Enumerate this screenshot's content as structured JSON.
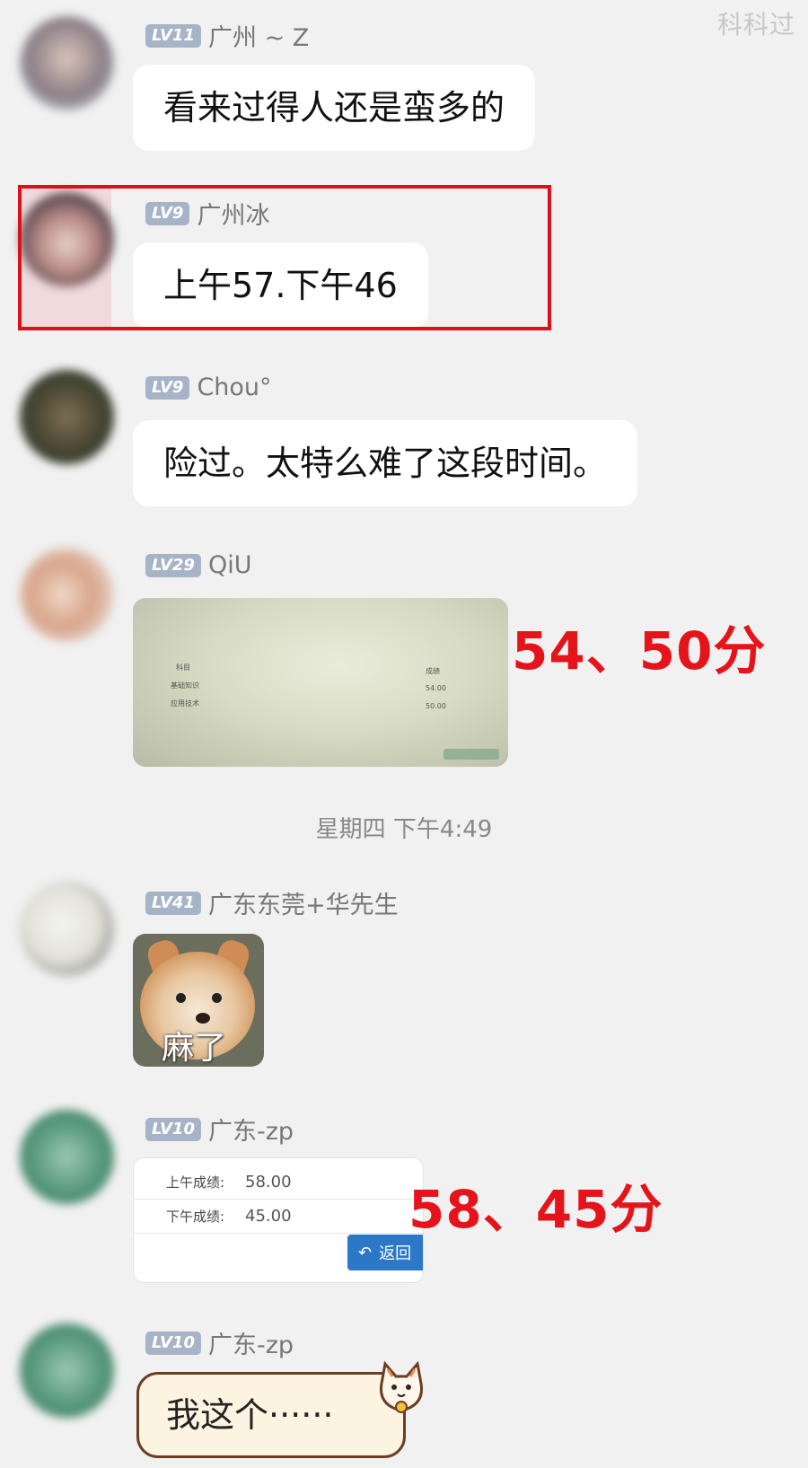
{
  "watermark": "科科过",
  "messages": [
    {
      "level": "LV11",
      "name": "广州 ~ Z",
      "text": "看来过得人还是蛮多的"
    },
    {
      "level": "LV9",
      "name": "广州冰",
      "text": "上午57.下午46"
    },
    {
      "level": "LV9",
      "name": "Chou°",
      "text": "险过。太特么难了这段时间。"
    },
    {
      "level": "LV29",
      "name": "QiU",
      "image": "score-photo"
    },
    {
      "level": "LV41",
      "name": "广东东莞+华先生",
      "sticker_caption": "麻了"
    },
    {
      "level": "LV10",
      "name": "广东-zp",
      "image": "score-screenshot"
    },
    {
      "level": "LV10",
      "name": "广东-zp",
      "text": "我这个······"
    }
  ],
  "timestamp": "星期四 下午4:49",
  "annotations": {
    "qiu_scores": "54、50分",
    "zp_scores": "58、45分"
  },
  "score_card": {
    "morning_label": "上午成绩:",
    "morning_value": "58.00",
    "afternoon_label": "下午成绩:",
    "afternoon_value": "45.00",
    "back_label": "返回"
  },
  "photo_texts": {
    "row1_left": "科目",
    "row2_left": "基础知识",
    "row3_left": "应用技术",
    "row1_right": "成绩",
    "row2_right": "54.00",
    "row3_right": "50.00"
  },
  "colors": {
    "background": "#f1f1f1",
    "level_badge": "#a7b4c8",
    "highlight_red": "#d8111a",
    "button_blue": "#2c78c8"
  }
}
